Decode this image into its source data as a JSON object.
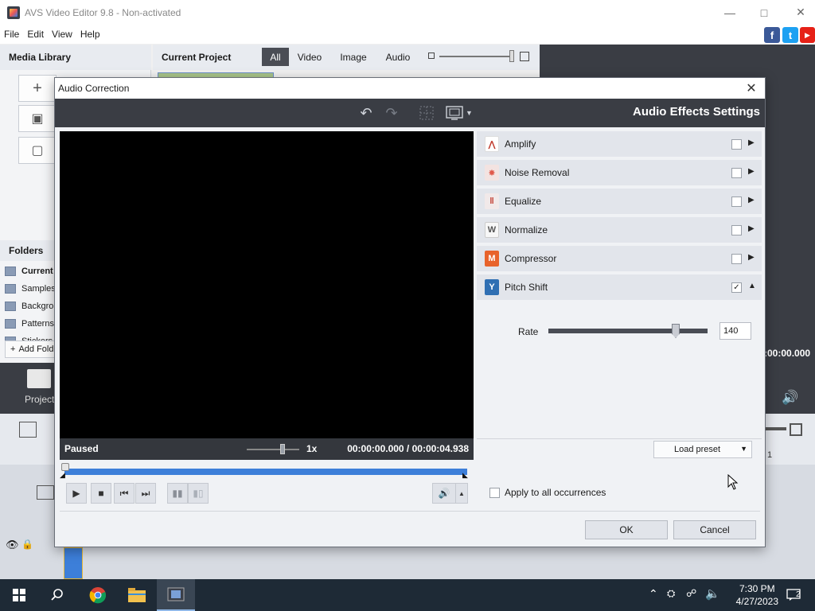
{
  "window": {
    "title": "AVS Video Editor 9.8 - Non-activated"
  },
  "menu": [
    "File",
    "Edit",
    "View",
    "Help"
  ],
  "social": [
    "f",
    "t",
    "▶"
  ],
  "media_library": {
    "title": "Media Library"
  },
  "current_project": {
    "title": "Current Project",
    "filters": [
      "All",
      "Video",
      "Image",
      "Audio"
    ],
    "active_filter": "All"
  },
  "folders": {
    "title": "Folders",
    "items": [
      "Current",
      "Samples",
      "Backgrou",
      "Patterns",
      "Stickers"
    ],
    "add_label": "Add Fold"
  },
  "bottom": {
    "projects_label": "Projects",
    "time_fragment": ":00:00.000",
    "ruler_mark": "1"
  },
  "dialog": {
    "title": "Audio Correction",
    "settings_title": "Audio Effects Settings",
    "status": "Paused",
    "speed": "1x",
    "time": "00:00:00.000  /  00:00:04.938",
    "playback_position": 0.0,
    "effects": [
      {
        "name": "Amplify",
        "checked": false,
        "expanded": false,
        "icon": "amplify-icon",
        "color": "#ffffff"
      },
      {
        "name": "Noise Removal",
        "checked": false,
        "expanded": false,
        "icon": "noise-removal-icon",
        "color": "#e05a4c"
      },
      {
        "name": "Equalize",
        "checked": false,
        "expanded": false,
        "icon": "equalize-icon",
        "color": "#c0392b"
      },
      {
        "name": "Normalize",
        "checked": false,
        "expanded": false,
        "icon": "normalize-icon",
        "color": "#f0f0f0"
      },
      {
        "name": "Compressor",
        "checked": false,
        "expanded": false,
        "icon": "compressor-icon",
        "color": "#e8632b"
      },
      {
        "name": "Pitch Shift",
        "checked": true,
        "expanded": true,
        "icon": "pitch-shift-icon",
        "color": "#2f6fb3"
      }
    ],
    "rate": {
      "label": "Rate",
      "value": "140",
      "fraction": 0.8
    },
    "load_preset": "Load preset",
    "apply_all": "Apply to all occurrences",
    "ok": "OK",
    "cancel": "Cancel"
  },
  "taskbar": {
    "time": "7:30 PM",
    "date": "4/27/2023",
    "notifications": "2"
  },
  "colors": {
    "accent": "#3d7fd9",
    "dark_toolbar": "#3a3d44",
    "taskbar": "#1e2a36"
  }
}
